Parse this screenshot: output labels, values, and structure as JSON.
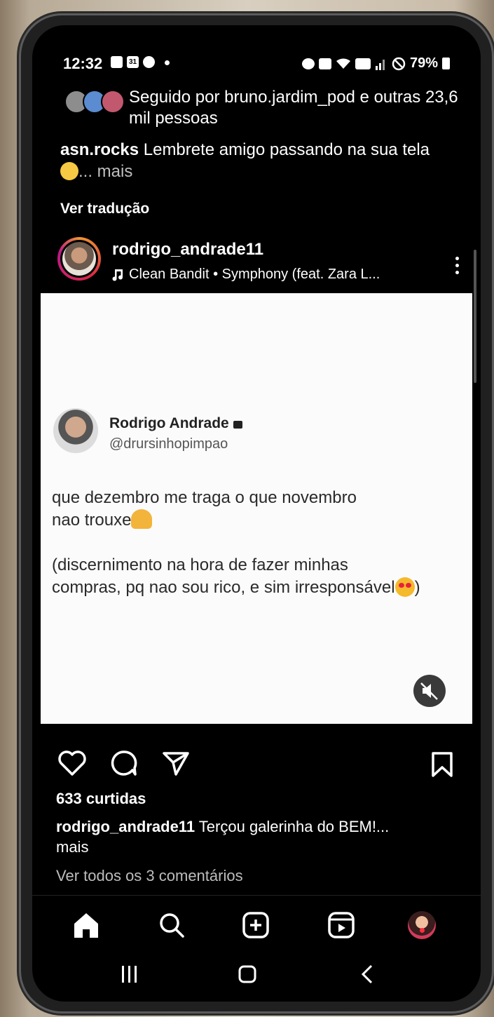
{
  "status_bar": {
    "time": "12:32",
    "calendar_day": "31",
    "battery": "79%"
  },
  "followed_by": {
    "text": "Seguido por bruno.jardim_pod e outras 23,6 mil pessoas"
  },
  "top_caption": {
    "user": "asn.rocks",
    "text": " Lembrete amigo passando na sua tela",
    "more": "... mais",
    "translate": "Ver tradução"
  },
  "post": {
    "username": "rodrigo_andrade11",
    "music": "Clean Bandit • Symphony (feat. Zara L...",
    "tweet": {
      "name": "Rodrigo Andrade",
      "handle": "@drursinhopimpao",
      "line1": "que dezembro me traga o que novembro",
      "line2": "nao trouxe",
      "line3": "(discernimento na hora de fazer minhas",
      "line4": "compras, pq nao sou rico, e sim irresponsável",
      "line4_end": ")"
    },
    "likes": "633 curtidas",
    "caption_user": "rodrigo_andrade11",
    "caption_text": " Terçou galerinha do BEM!...",
    "caption_more": "mais",
    "comments_link": "Ver todos os 3 comentários"
  },
  "icons": {
    "actions": [
      "heart-icon",
      "comment-icon",
      "share-icon",
      "bookmark-icon"
    ],
    "nav": [
      "home-icon",
      "search-icon",
      "create-icon",
      "reels-icon",
      "profile-avatar"
    ],
    "system": [
      "recents-button",
      "home-button",
      "back-button"
    ]
  }
}
